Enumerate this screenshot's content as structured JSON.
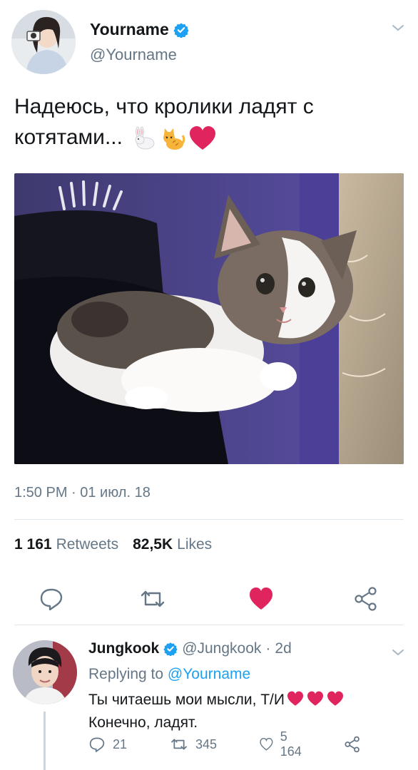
{
  "main_tweet": {
    "display_name": "Yourname",
    "handle": "@Yourname",
    "text": "Надеюсь, что кролики ладят с котятами...",
    "emojis": [
      "rabbit-emoji",
      "cat-emoji",
      "red-heart-emoji"
    ],
    "timestamp": "1:50 PM · 01 июл. 18",
    "retweets_count": "1 161",
    "retweets_label": "Retweets",
    "likes_count": "82,5K",
    "likes_label": "Likes"
  },
  "reply": {
    "display_name": "Jungkook",
    "handle": "@Jungkook",
    "separator": "·",
    "age": "2d",
    "replying_prefix": "Replying to",
    "replying_to": "@Yourname",
    "line1": "Ты читаешь мои мысли, Т/И",
    "line2": "Конечно, ладят.",
    "replies": "21",
    "retweets": "345",
    "likes": "5 164"
  },
  "colors": {
    "accent": "#1da1f2",
    "like_red": "#e0245e",
    "muted": "#657786",
    "text": "#14171a",
    "divider": "#e1e8ed"
  },
  "icons": [
    "verified-icon",
    "chevron-down-icon",
    "reply-icon",
    "retweet-icon",
    "like-icon",
    "share-icon"
  ]
}
